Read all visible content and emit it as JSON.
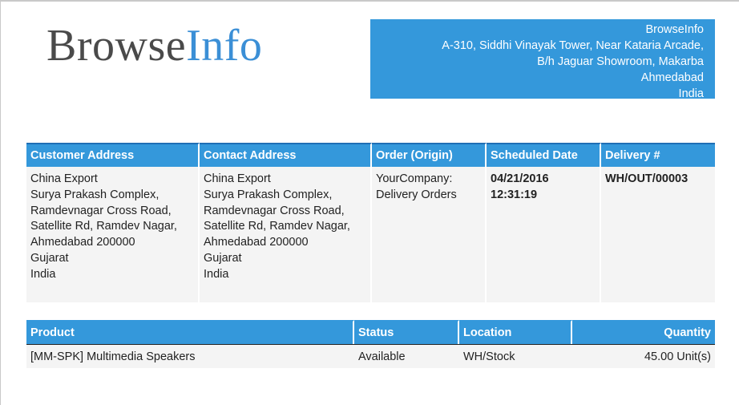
{
  "logo": {
    "part1": "Browse",
    "part2": "Info"
  },
  "company": {
    "lines": [
      "BrowseInfo",
      "A-310, Siddhi Vinayak Tower, Near Kataria Arcade,",
      "B/h Jaguar Showroom, Makarba",
      "Ahmedabad",
      "India"
    ]
  },
  "address_table": {
    "headers": [
      "Customer Address",
      "Contact Address",
      "Order (Origin)",
      "Scheduled Date",
      "Delivery #"
    ],
    "customer_address": [
      "China Export",
      "Surya Prakash Complex,",
      "Ramdevnagar Cross Road,",
      "Satellite Rd, Ramdev Nagar,",
      "Ahmedabad 200000",
      "Gujarat",
      "India"
    ],
    "contact_address": [
      "China Export",
      "Surya Prakash Complex,",
      "Ramdevnagar Cross Road,",
      "Satellite Rd, Ramdev Nagar,",
      "Ahmedabad 200000",
      "Gujarat",
      "India"
    ],
    "order_origin": [
      "YourCompany:",
      "Delivery Orders"
    ],
    "scheduled_date": "04/21/2016 12:31:19",
    "delivery_number": "WH/OUT/00003"
  },
  "product_table": {
    "headers": [
      "Product",
      "Status",
      "Location",
      "Quantity"
    ],
    "rows": [
      {
        "product": "[MM-SPK] Multimedia Speakers",
        "status": "Available",
        "location": "WH/Stock",
        "quantity": "45.00 Unit(s)"
      }
    ]
  },
  "colors": {
    "accent": "#3498db",
    "logo_gray": "#4a4a4a",
    "logo_blue": "#3b8fd6",
    "cell_bg": "#f4f4f4"
  }
}
